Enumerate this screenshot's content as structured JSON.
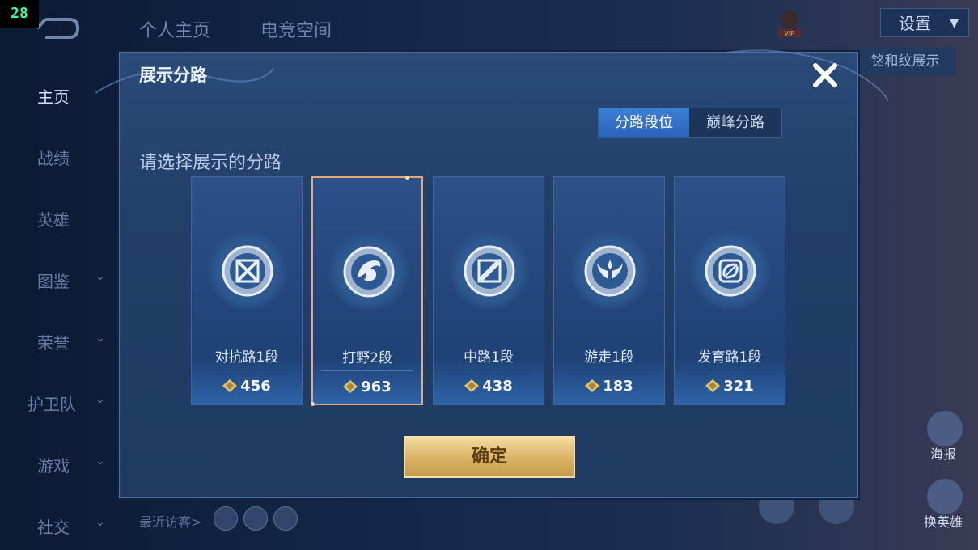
{
  "fps_counter": "28",
  "top_tabs": [
    "个人主页",
    "电竞空间"
  ],
  "header": {
    "vip_label": "VIP",
    "vip_text_lines": [
      "",
      ""
    ],
    "settings_label": "设置",
    "bg_tag_label": "铭和纹展示"
  },
  "sidebar": {
    "items": [
      {
        "label": "主页",
        "has_chevron": false,
        "active": true
      },
      {
        "label": "战绩",
        "has_chevron": false,
        "active": false
      },
      {
        "label": "英雄",
        "has_chevron": false,
        "active": false
      },
      {
        "label": "图鉴",
        "has_chevron": true,
        "active": false
      },
      {
        "label": "荣誉",
        "has_chevron": true,
        "active": false
      },
      {
        "label": "护卫队",
        "has_chevron": true,
        "active": false
      },
      {
        "label": "游戏",
        "has_chevron": true,
        "active": false
      },
      {
        "label": "社交",
        "has_chevron": true,
        "active": false
      }
    ]
  },
  "recent_visitors_label": "最近访客>",
  "right_side": {
    "poster_label": "海报",
    "change_hero_label": "换英雄"
  },
  "modal": {
    "title": "展示分路",
    "close_icon": "close-icon",
    "segment": {
      "options": [
        "分路段位",
        "巅峰分路"
      ],
      "selected": "分路段位"
    },
    "prompt": "请选择展示的分路",
    "cards": [
      {
        "rank": "对抗路1段",
        "points": "456",
        "icon": "crossed-swords-emblem-icon",
        "selected": false
      },
      {
        "rank": "打野2段",
        "points": "963",
        "icon": "dragon-emblem-icon",
        "selected": true
      },
      {
        "rank": "中路1段",
        "points": "438",
        "icon": "staff-emblem-icon",
        "selected": false
      },
      {
        "rank": "游走1段",
        "points": "183",
        "icon": "wings-emblem-icon",
        "selected": false
      },
      {
        "rank": "发育路1段",
        "points": "321",
        "icon": "bow-emblem-icon",
        "selected": false
      }
    ],
    "confirm_label": "确定"
  },
  "colors": {
    "accent_blue": "#2a64b8",
    "selected_border": "#e9a873",
    "confirm_gold": "#d9b163"
  }
}
